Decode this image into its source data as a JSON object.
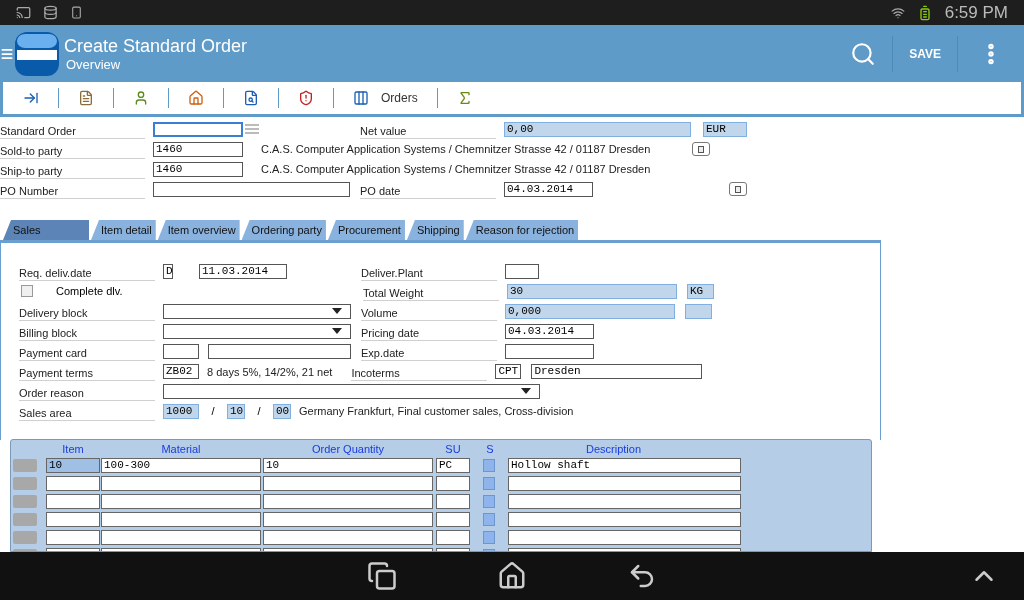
{
  "status_bar": {
    "time": "6:59 PM"
  },
  "app_bar": {
    "title": "Create Standard Order",
    "subtitle": "Overview",
    "save": "SAVE"
  },
  "toolbar": [
    {
      "kind": "icon"
    },
    {
      "kind": "icon"
    },
    {
      "kind": "icon"
    },
    {
      "kind": "icon"
    },
    {
      "kind": "icon"
    },
    {
      "kind": "icon"
    },
    {
      "kind": "labeled",
      "label": "Orders"
    },
    {
      "kind": "icon"
    }
  ],
  "header": {
    "standard_order": {
      "label": "Standard Order",
      "focused": true
    },
    "net_value": {
      "label": "Net value",
      "value": "0,00",
      "currency": "EUR"
    },
    "sold_to": {
      "label": "Sold-to party",
      "value": "1460",
      "description": "C.A.S. Computer Application Systems / Chemnitzer Strasse 42 / 01187 Dresden"
    },
    "ship_to": {
      "label": "Ship-to party",
      "value": "1460",
      "description": "C.A.S. Computer Application Systems / Chemnitzer Strasse 42 / 01187 Dresden"
    },
    "po_number": {
      "label": "PO Number"
    },
    "po_date": {
      "label": "PO date",
      "value": "04.03.2014"
    }
  },
  "tabs": [
    {
      "label": "Sales",
      "selected": true
    },
    {
      "label": "Item detail",
      "selected": false
    },
    {
      "label": "Item overview",
      "selected": false
    },
    {
      "label": "Ordering party",
      "selected": false
    },
    {
      "label": "Procurement",
      "selected": false
    },
    {
      "label": "Shipping",
      "selected": false
    },
    {
      "label": "Reason for rejection",
      "selected": false
    }
  ],
  "sales": {
    "req_deliv_date": {
      "label": "Req. deliv.date",
      "format": "D",
      "value": "11.03.2014"
    },
    "deliver_plant": {
      "label": "Deliver.Plant"
    },
    "complete_dlv": {
      "label": "Complete dlv.",
      "checked": false
    },
    "total_weight": {
      "label": "Total Weight",
      "value": "30",
      "unit": "KG"
    },
    "delivery_block": {
      "label": "Delivery block"
    },
    "volume": {
      "label": "Volume",
      "value": "0,000"
    },
    "billing_block": {
      "label": "Billing block"
    },
    "pricing_date": {
      "label": "Pricing date",
      "value": "04.03.2014"
    },
    "payment_card": {
      "label": "Payment card"
    },
    "exp_date": {
      "label": "Exp.date"
    },
    "payment_terms": {
      "label": "Payment terms",
      "value": "ZB02",
      "description": "8 days 5%, 14/2%, 21 net"
    },
    "incoterms": {
      "label": "Incoterms",
      "code": "CPT",
      "place": "Dresden"
    },
    "order_reason": {
      "label": "Order reason"
    },
    "sales_area": {
      "label": "Sales area",
      "parts": [
        "1000",
        "10",
        "00"
      ],
      "separators": [
        "/",
        "/"
      ],
      "description": "Germany Frankfurt, Final customer sales, Cross-division"
    }
  },
  "items_table": {
    "columns": [
      "Item",
      "Material",
      "Order Quantity",
      "SU",
      "S",
      "Description"
    ],
    "rows": [
      {
        "item": "10",
        "material": "100-300",
        "quantity": "10",
        "su": "PC",
        "description": "Hollow shaft"
      },
      {},
      {},
      {},
      {},
      {}
    ]
  }
}
